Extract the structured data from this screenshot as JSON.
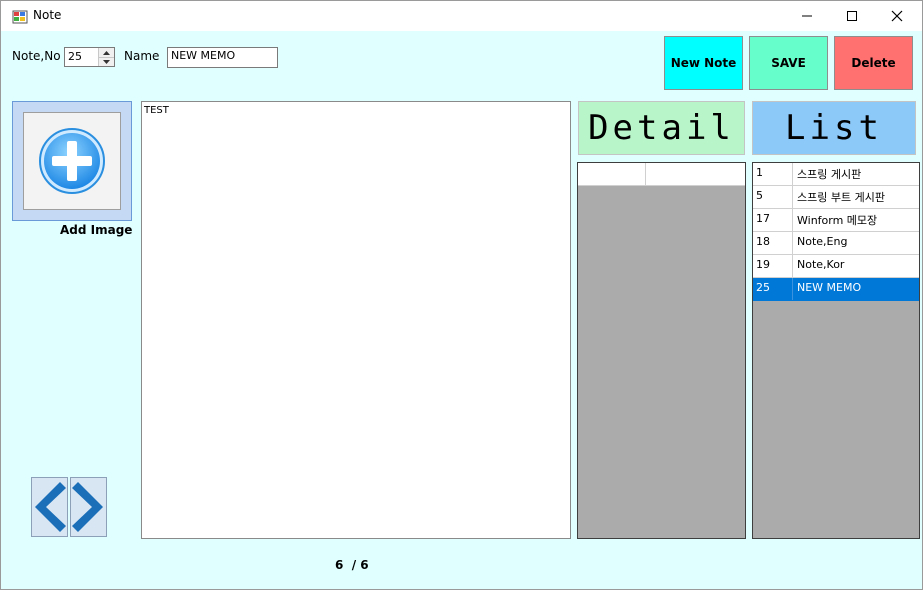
{
  "window": {
    "title": "Note",
    "controls": {
      "minimize": "minimize-icon",
      "maximize": "maximize-icon",
      "close": "close-icon"
    }
  },
  "form": {
    "note_no_label": "Note,No",
    "note_no_value": "25",
    "name_label": "Name",
    "name_value": "NEW MEMO"
  },
  "buttons": {
    "new_note": "New Note",
    "save": "SAVE",
    "delete": "Delete",
    "colors": {
      "new_note": "#00ffff",
      "save": "#66ffcc",
      "delete": "#ff7070"
    }
  },
  "image_panel": {
    "caption": "Add Image",
    "icon": "plus-circle-icon"
  },
  "memo": {
    "text": "TEST"
  },
  "detail": {
    "header": "Detail",
    "color": "#b8f5c8"
  },
  "list": {
    "header": "List",
    "color": "#8cc8f8",
    "rows": [
      {
        "id": "1",
        "name": "스프링 게시판"
      },
      {
        "id": "5",
        "name": "스프링 부트 게시판"
      },
      {
        "id": "17",
        "name": "Winform 메모장"
      },
      {
        "id": "18",
        "name": "Note,Eng"
      },
      {
        "id": "19",
        "name": "Note,Kor"
      },
      {
        "id": "25",
        "name": "NEW MEMO",
        "selected": true
      }
    ]
  },
  "navigation": {
    "prev": "chevron-left-icon",
    "next": "chevron-right-icon"
  },
  "pagination": {
    "text": "6  / 6"
  }
}
